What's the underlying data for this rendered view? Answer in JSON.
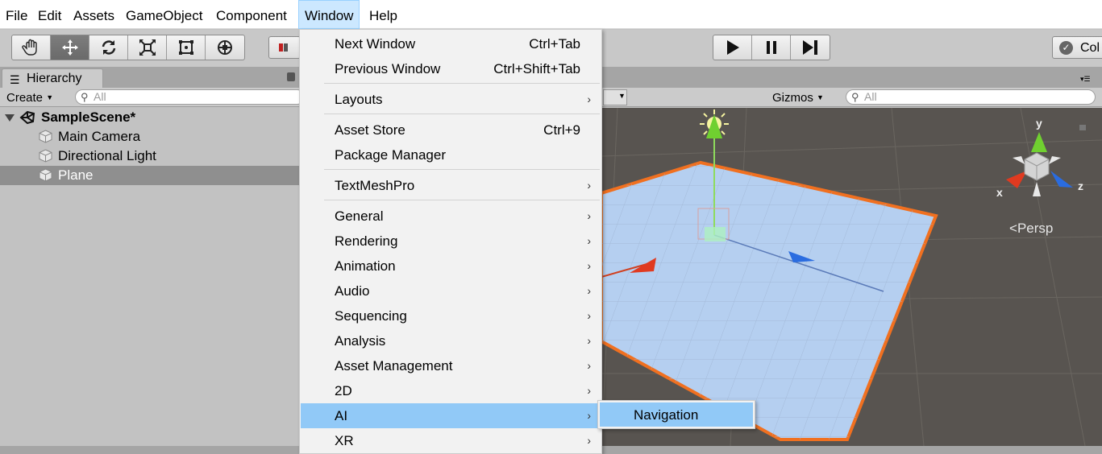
{
  "menubar": {
    "items": [
      "File",
      "Edit",
      "Assets",
      "GameObject",
      "Component",
      "Window",
      "Help"
    ],
    "active": "Window"
  },
  "toolbar": {
    "tools": [
      "hand-icon",
      "move-icon",
      "rotate-icon",
      "scale-icon",
      "rect-icon",
      "transform-icon"
    ],
    "active_tool": "move-icon",
    "playback": [
      "play-icon",
      "pause-icon",
      "step-icon"
    ],
    "collab_label": "Col"
  },
  "hierarchy": {
    "tab_label": "Hierarchy",
    "create_label": "Create",
    "search_placeholder": "All",
    "scene_name": "SampleScene*",
    "objects": [
      "Main Camera",
      "Directional Light",
      "Plane"
    ],
    "selected": "Plane"
  },
  "scene": {
    "gizmos_label": "Gizmos",
    "search_placeholder": "All",
    "persp_label": "Persp",
    "axis_labels": [
      "y",
      "x",
      "z"
    ]
  },
  "window_menu": {
    "items": [
      {
        "label": "Next Window",
        "shortcut": "Ctrl+Tab",
        "submenu": false
      },
      {
        "label": "Previous Window",
        "shortcut": "Ctrl+Shift+Tab",
        "submenu": false
      },
      {
        "label": "Layouts",
        "shortcut": "",
        "submenu": true
      },
      {
        "label": "Asset Store",
        "shortcut": "Ctrl+9",
        "submenu": false
      },
      {
        "label": "Package Manager",
        "shortcut": "",
        "submenu": false
      },
      {
        "label": "TextMeshPro",
        "shortcut": "",
        "submenu": true
      },
      {
        "label": "General",
        "shortcut": "",
        "submenu": true
      },
      {
        "label": "Rendering",
        "shortcut": "",
        "submenu": true
      },
      {
        "label": "Animation",
        "shortcut": "",
        "submenu": true
      },
      {
        "label": "Audio",
        "shortcut": "",
        "submenu": true
      },
      {
        "label": "Sequencing",
        "shortcut": "",
        "submenu": true
      },
      {
        "label": "Analysis",
        "shortcut": "",
        "submenu": true
      },
      {
        "label": "Asset Management",
        "shortcut": "",
        "submenu": true
      },
      {
        "label": "2D",
        "shortcut": "",
        "submenu": true
      },
      {
        "label": "AI",
        "shortcut": "",
        "submenu": true
      },
      {
        "label": "XR",
        "shortcut": "",
        "submenu": true
      }
    ],
    "highlighted": "AI",
    "submenu_item": "Navigation",
    "submenu_glyph": "›"
  },
  "colors": {
    "menu_highlight": "#91c9f7",
    "selection_outline": "#f07020",
    "axis_x": "#e03a20",
    "axis_y": "#70d030",
    "axis_z": "#2a6ce0"
  }
}
